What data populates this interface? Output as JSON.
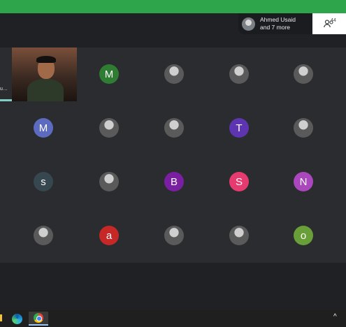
{
  "colors": {
    "topbar": "#2ea54b",
    "background": "#202124",
    "grid": "#2b2c30",
    "accent": "#7fcfc4"
  },
  "header": {
    "pill_name": "Ahmed Usaid",
    "pill_more": "and 7 more",
    "people_count": "44",
    "people_icon": "people-icon"
  },
  "left_participant": {
    "name_truncated": "u…"
  },
  "participants": [
    {
      "type": "video",
      "name": "video"
    },
    {
      "type": "letter",
      "letter": "M",
      "color": "#2e7d32"
    },
    {
      "type": "photo"
    },
    {
      "type": "photo"
    },
    {
      "type": "photo"
    },
    {
      "type": "letter",
      "letter": "M",
      "color": "#5c6bc0"
    },
    {
      "type": "photo"
    },
    {
      "type": "photo"
    },
    {
      "type": "letter",
      "letter": "T",
      "color": "#5e35b1"
    },
    {
      "type": "photo"
    },
    {
      "type": "letter",
      "letter": "s",
      "color": "#37474f"
    },
    {
      "type": "photo"
    },
    {
      "type": "letter",
      "letter": "B",
      "color": "#7b1fa2"
    },
    {
      "type": "letter",
      "letter": "S",
      "color": "#e63b6f"
    },
    {
      "type": "letter",
      "letter": "N",
      "color": "#ab47bc"
    },
    {
      "type": "photo"
    },
    {
      "type": "letter",
      "letter": "a",
      "color": "#c62828"
    },
    {
      "type": "photo"
    },
    {
      "type": "photo"
    },
    {
      "type": "letter",
      "letter": "o",
      "color": "#689f38"
    }
  ],
  "taskbar": {
    "items": [
      "edge-icon",
      "chrome-icon"
    ],
    "tray_chevron": "^"
  }
}
